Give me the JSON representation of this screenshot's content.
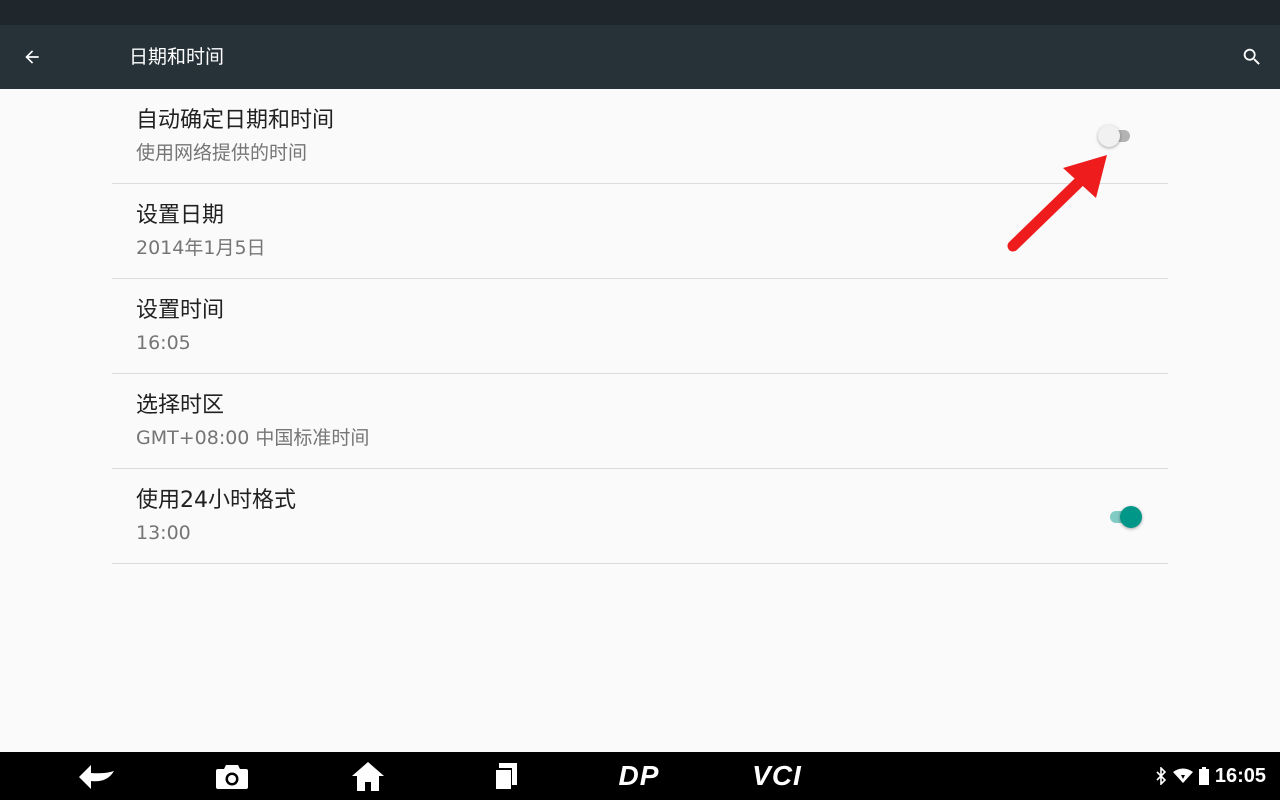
{
  "appbar": {
    "title": "日期和时间",
    "back_icon": "arrow-left-icon",
    "search_icon": "search-icon"
  },
  "settings": {
    "items": [
      {
        "title": "自动确定日期和时间",
        "summary": "使用网络提供的时间",
        "toggle": "off"
      },
      {
        "title": "设置日期",
        "summary": "2014年1月5日"
      },
      {
        "title": "设置时间",
        "summary": "16:05"
      },
      {
        "title": "选择时区",
        "summary": "GMT+08:00 中国标准时间"
      },
      {
        "title": "使用24小时格式",
        "summary": "13:00",
        "toggle": "on"
      }
    ]
  },
  "navbar": {
    "buttons": [
      "back-icon",
      "camera-icon",
      "home-icon",
      "recents-icon",
      "dp-logo",
      "vci-logo"
    ],
    "dp_label": "DP",
    "vci_label": "VCI",
    "clock": "16:05",
    "status_icons": [
      "bluetooth-icon",
      "wifi-icon",
      "battery-icon"
    ]
  },
  "colors": {
    "appbar": "#263238",
    "accent": "#009688",
    "annotation_arrow": "#ee1c1c"
  }
}
